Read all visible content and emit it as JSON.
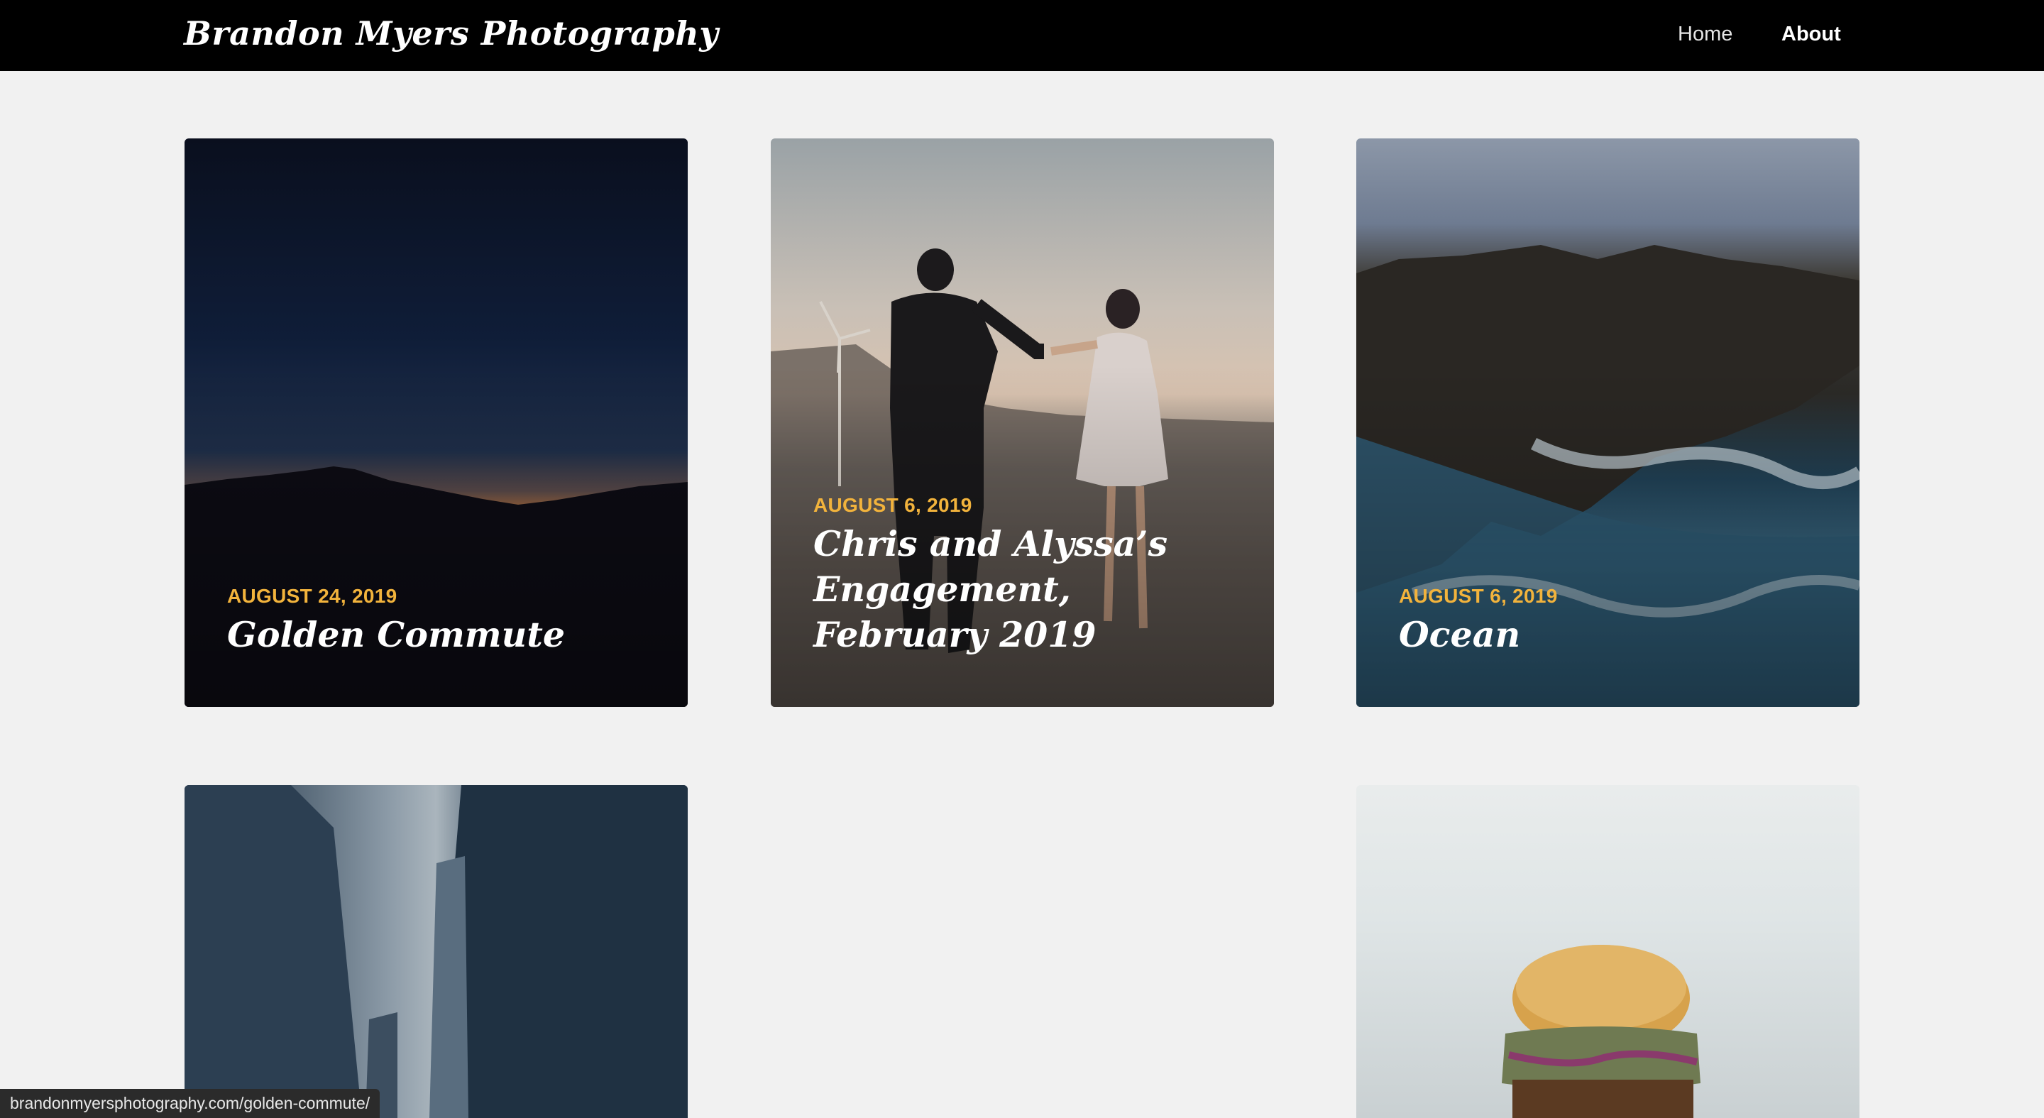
{
  "header": {
    "site_title": "Brandon Myers Photography",
    "nav": [
      {
        "label": "Home"
      },
      {
        "label": "About"
      }
    ]
  },
  "posts": [
    {
      "date": "AUGUST 24, 2019",
      "title": "Golden Commute"
    },
    {
      "date": "AUGUST 6, 2019",
      "title": "Chris and Alyssa’s Engagement, February 2019"
    },
    {
      "date": "AUGUST 6, 2019",
      "title": "Ocean"
    }
  ],
  "status_bar": {
    "url": "brandonmyersphotography.com/golden-commute/"
  },
  "colors": {
    "header_bg": "#000000",
    "page_bg": "#f1f1f1",
    "date_accent": "#f2b33c"
  }
}
